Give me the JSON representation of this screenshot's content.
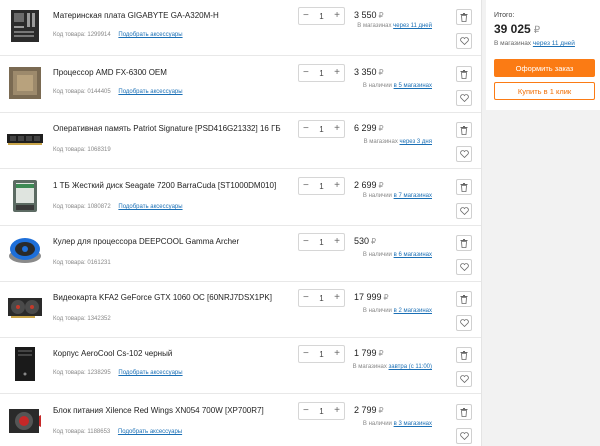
{
  "cart": {
    "items": [
      {
        "name": "Материнская плата GIGABYTE GA-A320M-H",
        "code": "Код товара: 1299914",
        "accessories": "Подобрать аксессуары",
        "qty": "1",
        "price": "3 550",
        "currency": "₽",
        "avail_prefix": "В магазинах",
        "avail_link": "через 11 дней",
        "icon": "motherboard-icon"
      },
      {
        "name": "Процессор AMD FX-6300 OEM",
        "code": "Код товара: 0144405",
        "accessories": "Подобрать аксессуары",
        "qty": "1",
        "price": "3 350",
        "currency": "₽",
        "avail_prefix": "В наличии",
        "avail_link": "в 5 магазинах",
        "icon": "cpu-icon"
      },
      {
        "name": "Оперативная память Patriot Signature [PSD416G21332] 16 ГБ",
        "code": "Код товара: 1068319",
        "accessories": "",
        "qty": "1",
        "price": "6 299",
        "currency": "₽",
        "avail_prefix": "В магазинах",
        "avail_link": "через 3 дня",
        "icon": "ram-icon"
      },
      {
        "name": "1 ТБ Жесткий диск Seagate 7200 BarraCuda [ST1000DM010]",
        "code": "Код товара: 1080872",
        "accessories": "Подобрать аксессуары",
        "qty": "1",
        "price": "2 699",
        "currency": "₽",
        "avail_prefix": "В наличии",
        "avail_link": "в 7 магазинах",
        "icon": "hdd-icon"
      },
      {
        "name": "Кулер для процессора DEEPCOOL Gamma Archer",
        "code": "Код товара: 0161231",
        "accessories": "",
        "qty": "1",
        "price": "530",
        "currency": "₽",
        "avail_prefix": "В наличии",
        "avail_link": "в 6 магазинах",
        "icon": "cooler-icon"
      },
      {
        "name": "Видеокарта KFA2 GeForce GTX 1060 OC [60NRJ7DSX1PK]",
        "code": "Код товара: 1342352",
        "accessories": "",
        "qty": "1",
        "price": "17 999",
        "currency": "₽",
        "avail_prefix": "В наличии",
        "avail_link": "в 2 магазинах",
        "icon": "gpu-icon"
      },
      {
        "name": "Корпус AeroCool Cs-102 черный",
        "code": "Код товара: 1238295",
        "accessories": "Подобрать аксессуары",
        "qty": "1",
        "price": "1 799",
        "currency": "₽",
        "avail_prefix": "В магазинах",
        "avail_link": "завтра (с 11:00)",
        "icon": "case-icon"
      },
      {
        "name": "Блок питания Xilence Red Wings XN054 700W [XP700R7]",
        "code": "Код товара: 1188653",
        "accessories": "Подобрать аксессуары",
        "qty": "1",
        "price": "2 799",
        "currency": "₽",
        "avail_prefix": "В наличии",
        "avail_link": "в 3 магазинах",
        "icon": "psu-icon"
      }
    ],
    "minus": "−",
    "plus": "+"
  },
  "summary": {
    "label": "Итого:",
    "total": "39 025",
    "currency": "₽",
    "avail_prefix": "В магазинах",
    "avail_link": "через 11 дней",
    "order_button": "Оформить заказ",
    "oneclick_button": "Купить в 1 клик"
  },
  "colors": {
    "accent": "#fb7b14",
    "link": "#1a6fb5"
  }
}
